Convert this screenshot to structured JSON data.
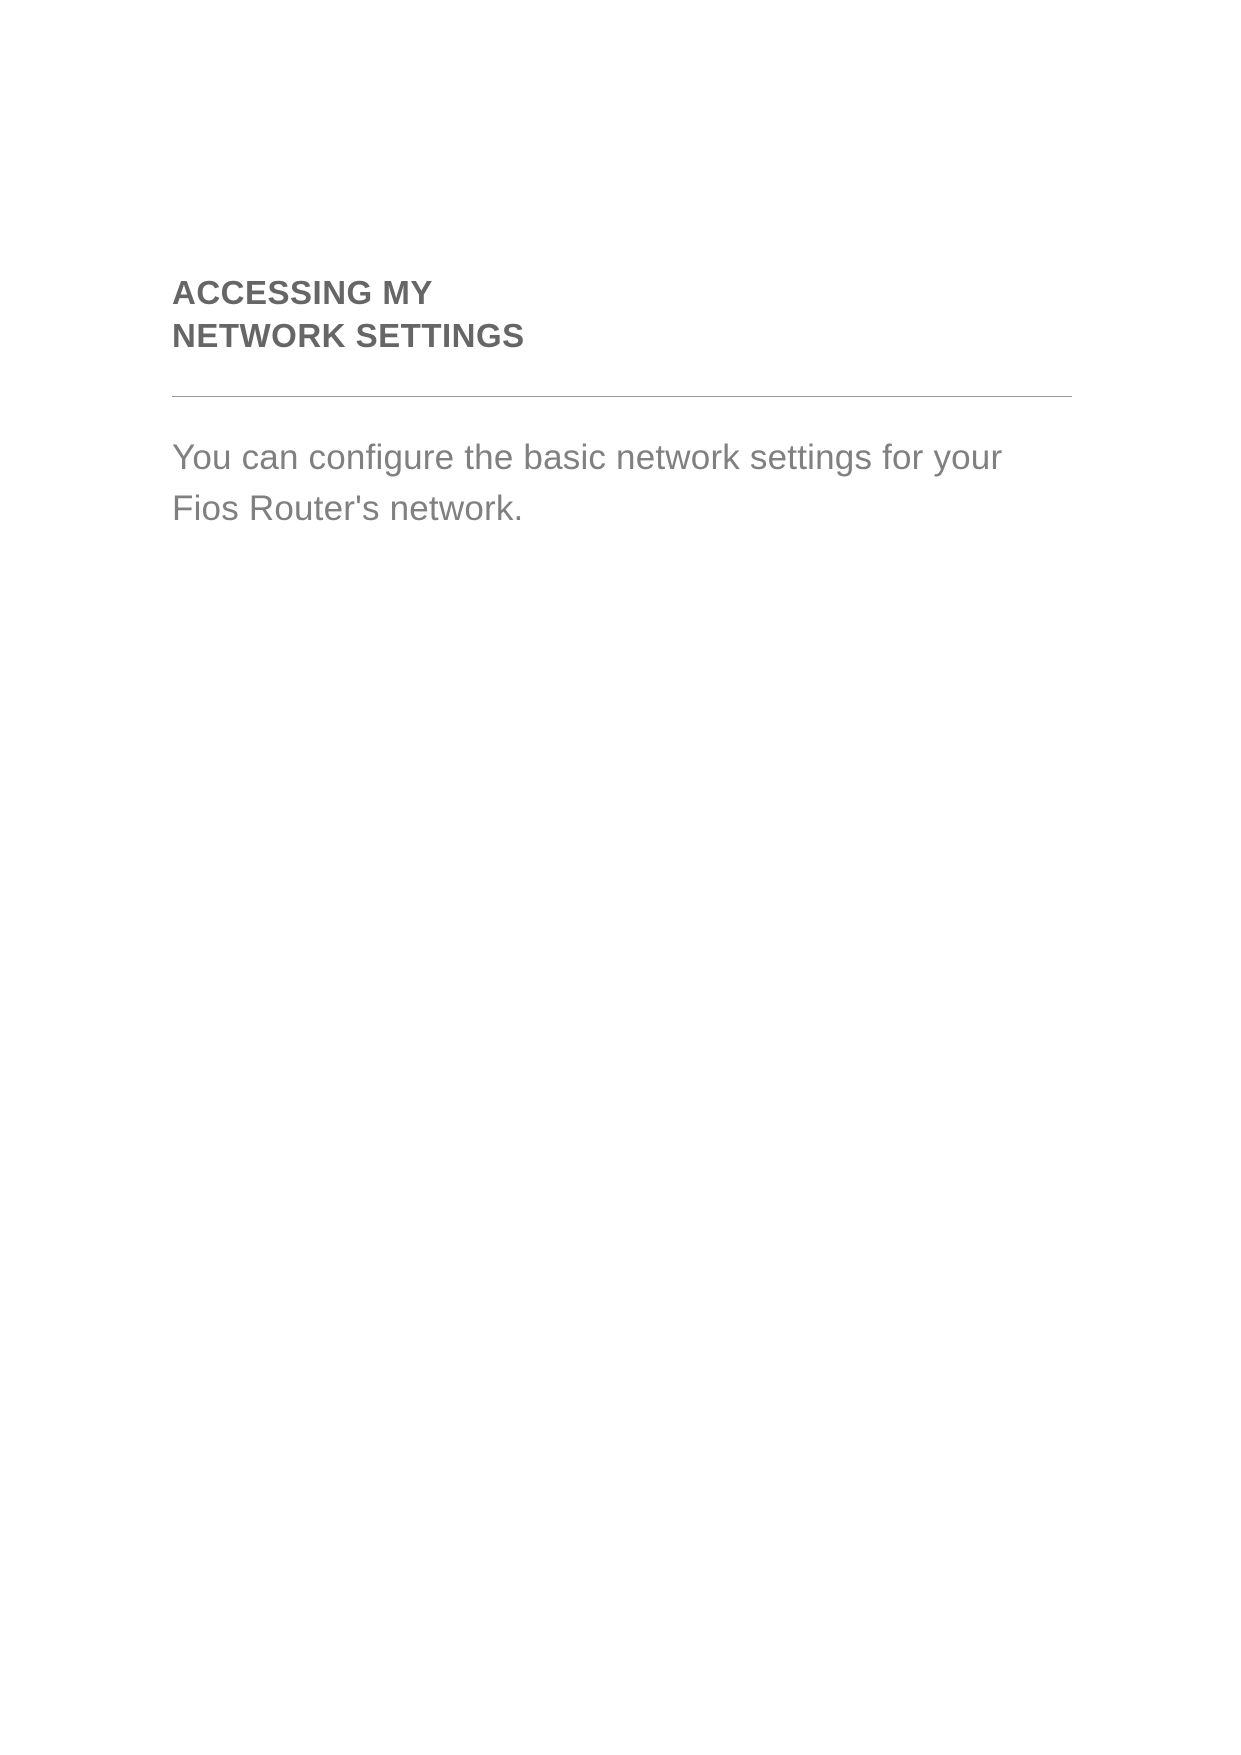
{
  "heading": {
    "line1": "ACCESSING MY",
    "line2": "NETWORK SETTINGS"
  },
  "intro": "You can configure the basic network settings for your Fios Router's network."
}
